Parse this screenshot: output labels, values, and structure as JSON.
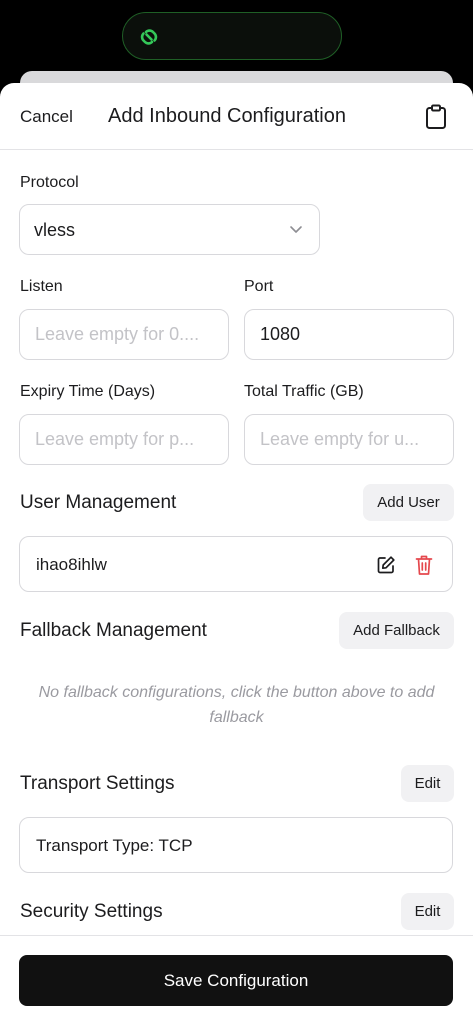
{
  "nav": {
    "cancel_label": "Cancel",
    "title": "Add Inbound Configuration"
  },
  "protocol": {
    "label": "Protocol",
    "value": "vless"
  },
  "listen": {
    "label": "Listen",
    "placeholder": "Leave empty for 0...."
  },
  "port": {
    "label": "Port",
    "value": "1080"
  },
  "expiry": {
    "label": "Expiry Time (Days)",
    "placeholder": "Leave empty for p..."
  },
  "traffic": {
    "label": "Total Traffic (GB)",
    "placeholder": "Leave empty for u..."
  },
  "users": {
    "title": "User Management",
    "add_label": "Add User",
    "items": [
      {
        "name": "ihao8ihlw"
      }
    ]
  },
  "fallback": {
    "title": "Fallback Management",
    "add_label": "Add Fallback",
    "empty_message": "No fallback configurations, click the button above to add fallback"
  },
  "transport": {
    "title": "Transport Settings",
    "edit_label": "Edit",
    "summary": "Transport Type: TCP"
  },
  "security": {
    "title": "Security Settings",
    "edit_label": "Edit"
  },
  "footer": {
    "save_label": "Save Configuration"
  },
  "colors": {
    "accent_green": "#34c759",
    "delete_red": "#e5484d",
    "primary_button": "#111111"
  },
  "icons": {
    "island": "link-icon",
    "nav_right": "clipboard-icon",
    "user_edit": "edit-icon",
    "user_delete": "trash-icon",
    "select": "chevron-down-icon"
  }
}
